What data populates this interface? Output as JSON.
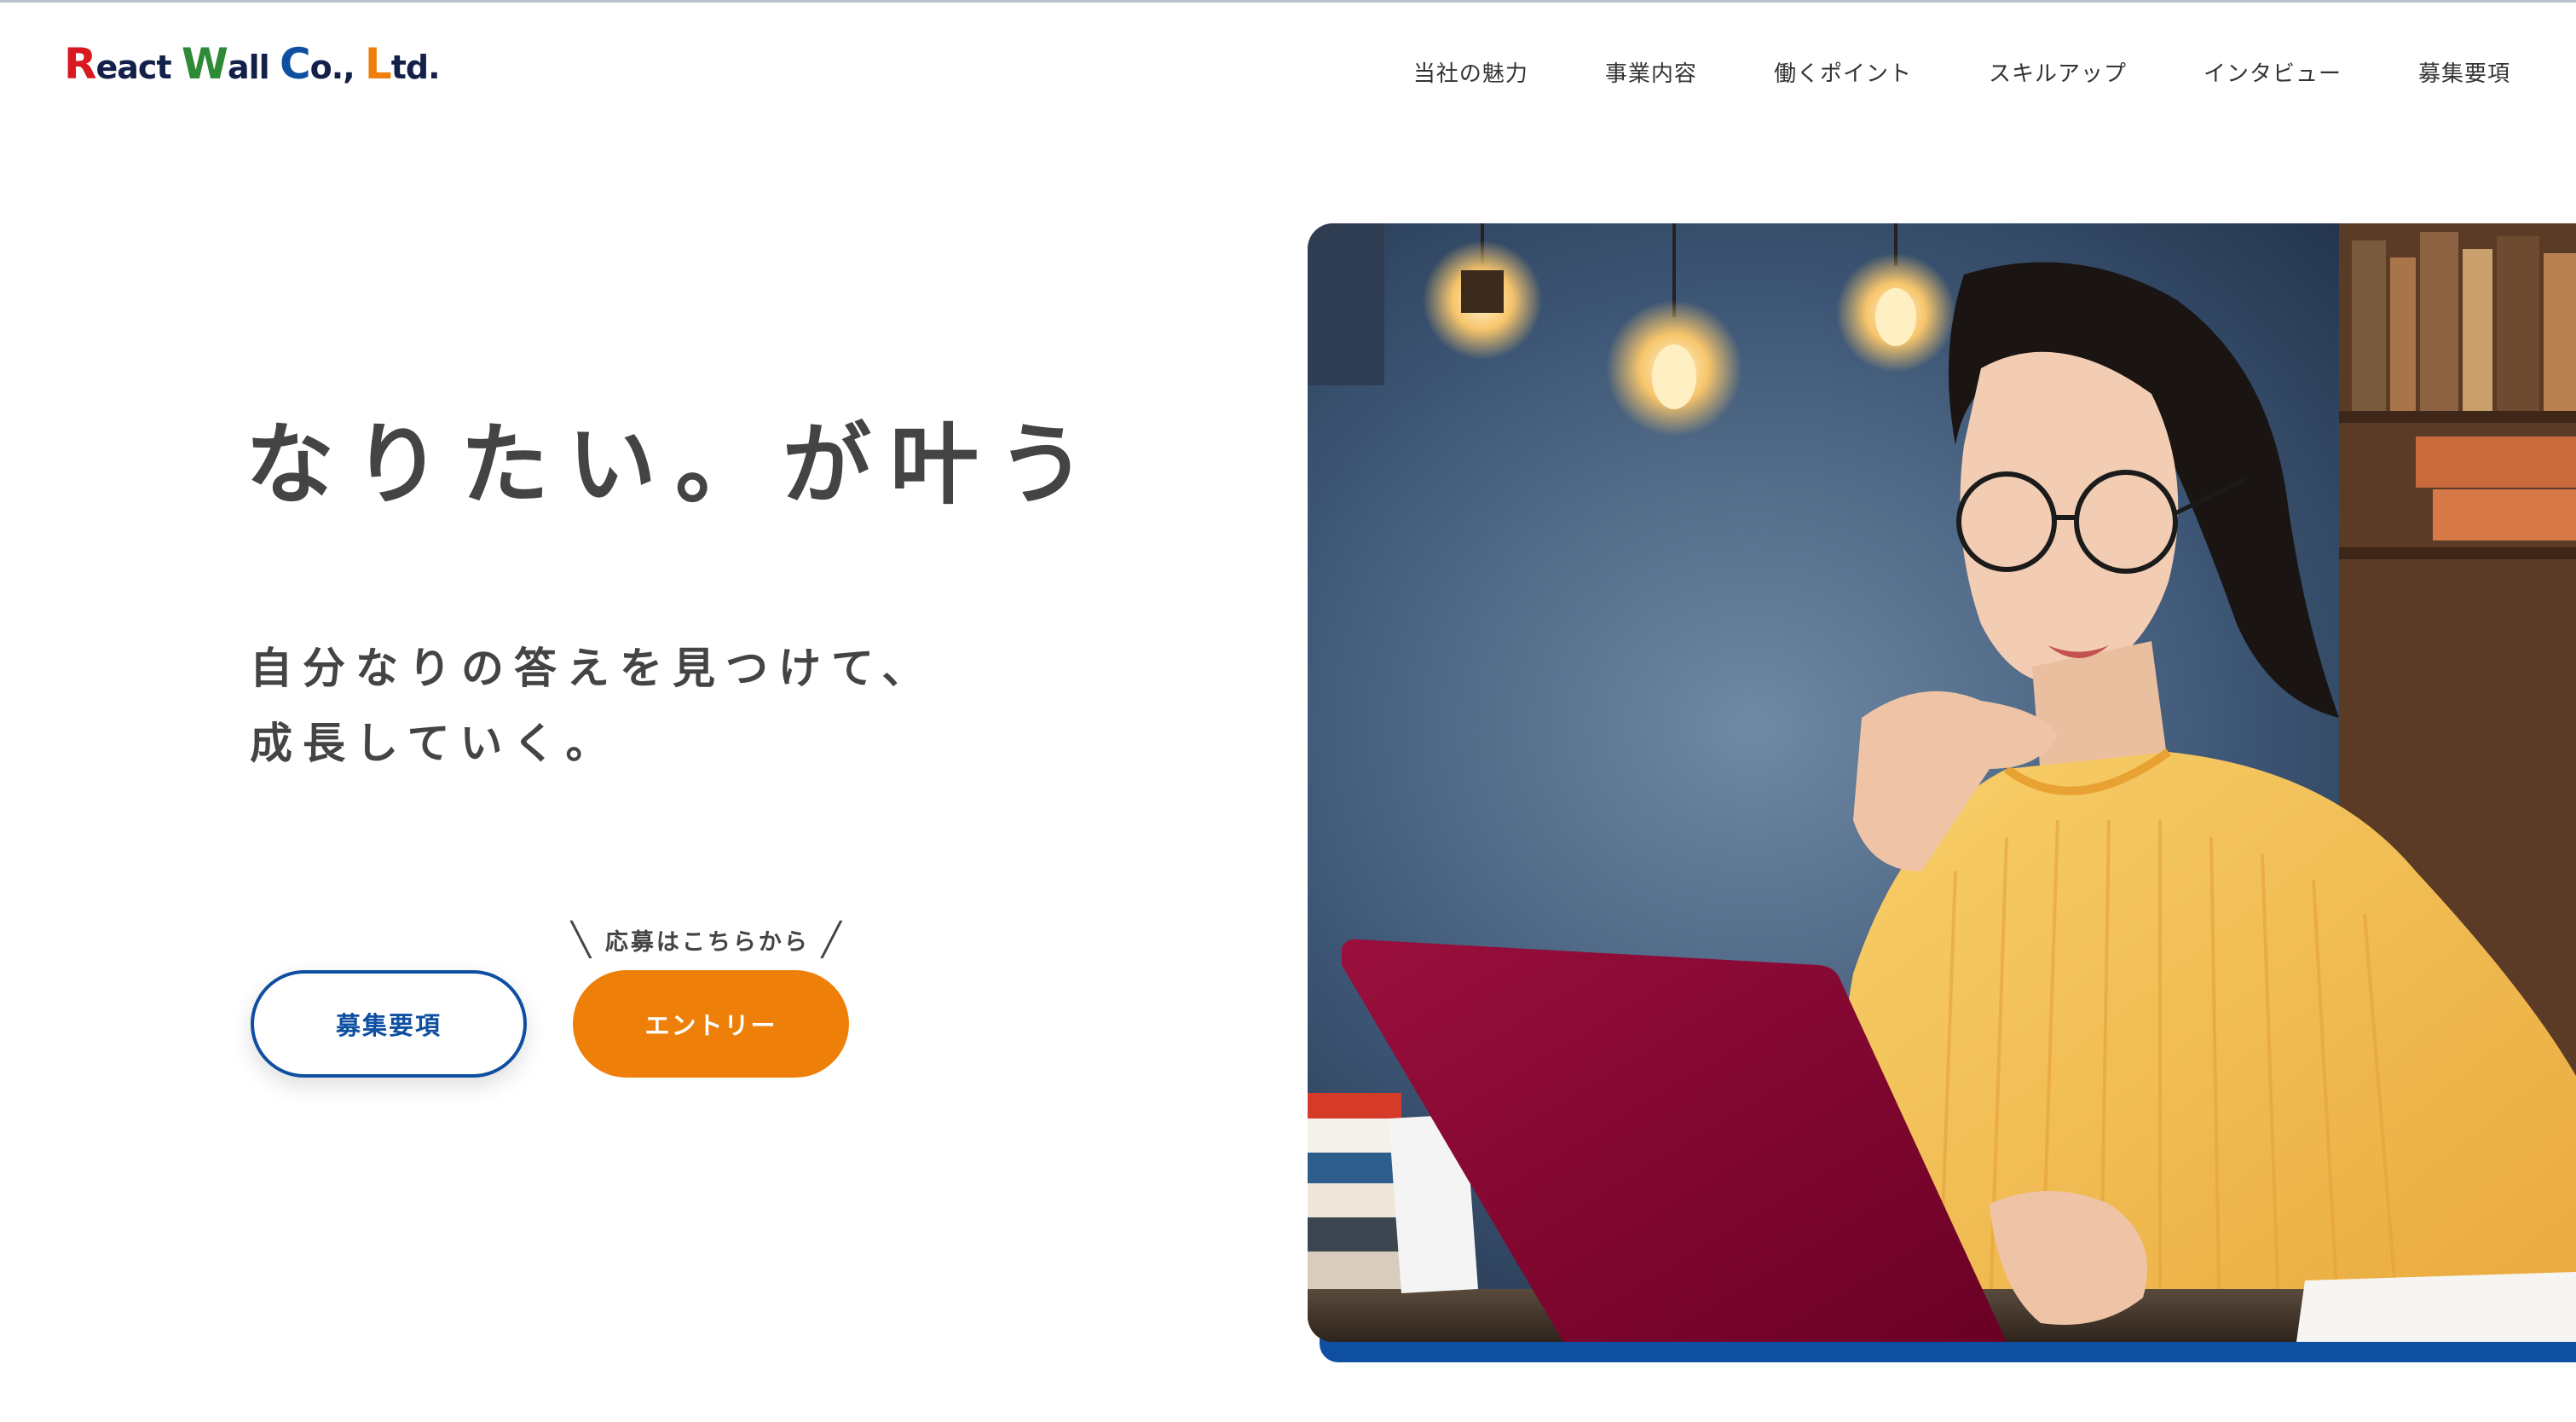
{
  "header": {
    "logo": {
      "letters": [
        "R",
        "eact ",
        "W",
        "all ",
        "C",
        "o., ",
        "L",
        "td."
      ],
      "colors": {
        "R": "#d71920",
        "W": "#2e8a37",
        "C": "#0e4fa1",
        "L": "#ee8009",
        "rest": "#13204a"
      }
    },
    "nav": [
      "当社の魅力",
      "事業内容",
      "働くポイント",
      "スキルアップ",
      "インタビュー",
      "募集要項"
    ]
  },
  "hero": {
    "headline": "なりたい。が叶う",
    "subtext": [
      "自分なりの答えを見つけて、",
      "成長していく。"
    ],
    "apply_note": "応募はこちらから",
    "buttons": {
      "requirements": "募集要項",
      "entry": "エントリー"
    },
    "image_description_icon": "woman-with-laptop-photo"
  },
  "colors": {
    "brand_blue": "#0e4fa1",
    "accent_orange": "#ee8009",
    "text": "#444444"
  }
}
